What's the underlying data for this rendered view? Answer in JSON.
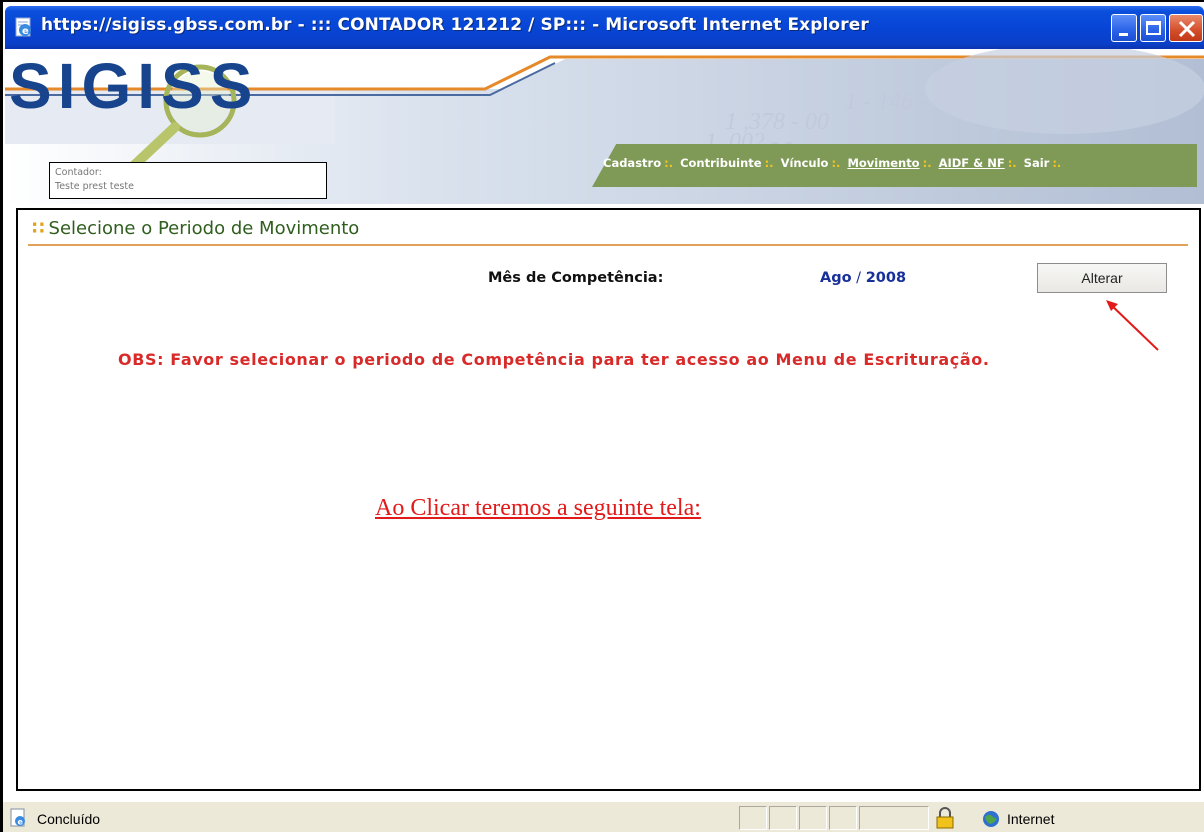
{
  "window": {
    "title": "https://sigiss.gbss.com.br - ::: CONTADOR 121212 / SP::: - Microsoft Internet Explorer"
  },
  "header": {
    "logo": "SIGISS",
    "nav": [
      {
        "label": "Cadastro",
        "underlined": false
      },
      {
        "label": "Contribuinte",
        "underlined": false
      },
      {
        "label": "Vínculo",
        "underlined": false
      },
      {
        "label": "Movimento",
        "underlined": true
      },
      {
        "label": "AIDF & NF",
        "underlined": true
      },
      {
        "label": "Sair",
        "underlined": false
      }
    ],
    "nav_separator": ":.",
    "contador_label": "Contador:",
    "contador_name": "Teste prest teste"
  },
  "main": {
    "section_title": "Selecione o Periodo de Movimento",
    "mes_label": "Mês de Competência:",
    "mes_month": "Ago",
    "mes_sep": " / ",
    "mes_year": "2008",
    "alterar_label": "Alterar",
    "obs": "OBS: Favor selecionar o periodo de Competência para ter acesso ao Menu de Escrituração.",
    "annotation": "Ao Clicar teremos a seguinte tela:"
  },
  "status": {
    "text": "Concluído",
    "zone": "Internet"
  },
  "colors": {
    "accent_red": "#e21a1a",
    "nav_green": "#7f9957",
    "logo_blue": "#17448c",
    "title_green": "#2f5e1e"
  }
}
